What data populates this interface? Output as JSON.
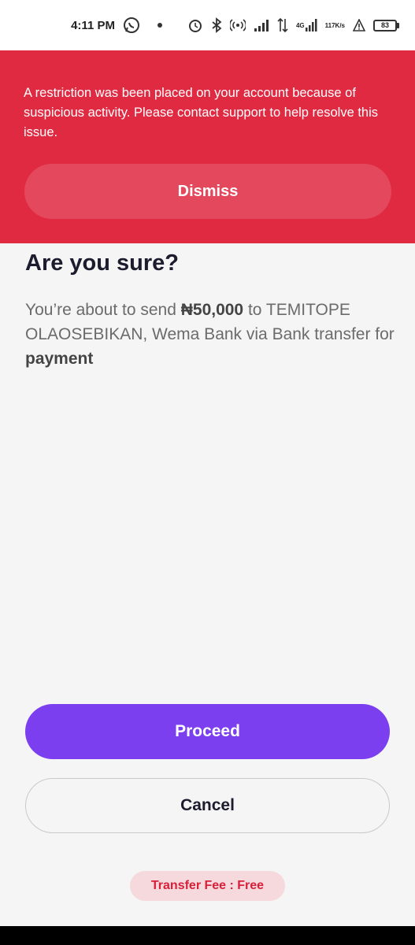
{
  "status_bar": {
    "time": "4:11 PM",
    "network_type": "4G",
    "net_speed_value": "117",
    "net_speed_unit": "K/s",
    "battery_level": "83",
    "icons": [
      "whatsapp-icon",
      "alarm-icon",
      "bluetooth-icon",
      "hotspot-icon",
      "signal-icon",
      "data-arrows-icon",
      "signal-4g-icon",
      "warning-icon",
      "battery-icon"
    ]
  },
  "banner": {
    "message": "A restriction was been placed on your account because of suspicious activity. Please contact support to help resolve this issue.",
    "dismiss_label": "Dismiss",
    "background_color": "#e02a42"
  },
  "confirm": {
    "title": "Are you sure?",
    "desc_prefix": "You’re about to send ",
    "amount": "₦50,000",
    "desc_middle": " to TEMITOPE OLAOSEBIKAN, Wema Bank via Bank transfer for ",
    "purpose": "payment"
  },
  "actions": {
    "proceed_label": "Proceed",
    "cancel_label": "Cancel",
    "accent_color": "#7b3fef"
  },
  "fee": {
    "label": "Transfer Fee : Free"
  }
}
